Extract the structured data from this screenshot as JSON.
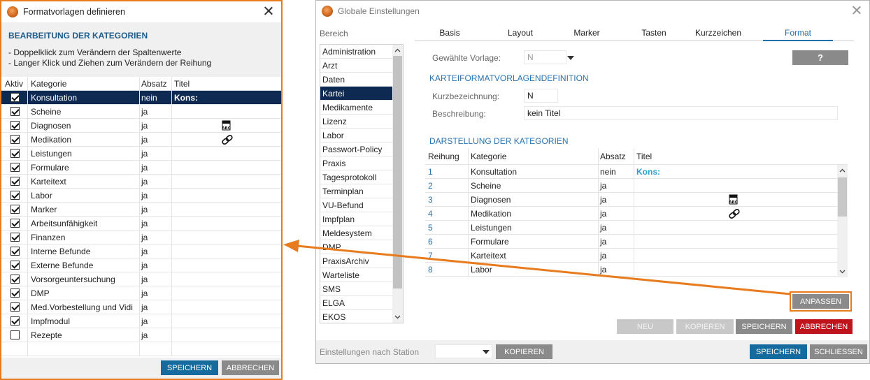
{
  "left_window": {
    "title": "Formatvorlagen definieren",
    "heading": "BEARBEITUNG DER KATEGORIEN",
    "instructions": [
      "- Doppelklick zum Verändern der Spaltenwerte",
      "- Langer Klick und Ziehen zum Verändern der Reihung"
    ],
    "columns": [
      "Aktiv",
      "Kategorie",
      "Absatz",
      "Titel"
    ],
    "rows": [
      {
        "checked": true,
        "kategorie": "Konsultation",
        "absatz": "nein",
        "titel": "Kons:",
        "icon": ""
      },
      {
        "checked": true,
        "kategorie": "Scheine",
        "absatz": "ja",
        "titel": "",
        "icon": ""
      },
      {
        "checked": true,
        "kategorie": "Diagnosen",
        "absatz": "ja",
        "titel": "",
        "icon": "abc-document-icon"
      },
      {
        "checked": true,
        "kategorie": "Medikation",
        "absatz": "ja",
        "titel": "",
        "icon": "pill-icon"
      },
      {
        "checked": true,
        "kategorie": "Leistungen",
        "absatz": "ja",
        "titel": "",
        "icon": ""
      },
      {
        "checked": true,
        "kategorie": "Formulare",
        "absatz": "ja",
        "titel": "",
        "icon": ""
      },
      {
        "checked": true,
        "kategorie": "Karteitext",
        "absatz": "ja",
        "titel": "",
        "icon": ""
      },
      {
        "checked": true,
        "kategorie": "Labor",
        "absatz": "ja",
        "titel": "",
        "icon": ""
      },
      {
        "checked": true,
        "kategorie": "Marker",
        "absatz": "ja",
        "titel": "",
        "icon": ""
      },
      {
        "checked": true,
        "kategorie": "Arbeitsunfähigkeit",
        "absatz": "ja",
        "titel": "",
        "icon": ""
      },
      {
        "checked": true,
        "kategorie": "Finanzen",
        "absatz": "ja",
        "titel": "",
        "icon": ""
      },
      {
        "checked": true,
        "kategorie": "Interne Befunde",
        "absatz": "ja",
        "titel": "",
        "icon": ""
      },
      {
        "checked": true,
        "kategorie": "Externe Befunde",
        "absatz": "ja",
        "titel": "",
        "icon": ""
      },
      {
        "checked": true,
        "kategorie": "Vorsorgeuntersuchung",
        "absatz": "ja",
        "titel": "",
        "icon": ""
      },
      {
        "checked": true,
        "kategorie": "DMP",
        "absatz": "ja",
        "titel": "",
        "icon": ""
      },
      {
        "checked": true,
        "kategorie": "Med.Vorbestellung und Vidi",
        "absatz": "ja",
        "titel": "",
        "icon": ""
      },
      {
        "checked": true,
        "kategorie": "Impfmodul",
        "absatz": "ja",
        "titel": "",
        "icon": ""
      },
      {
        "checked": false,
        "kategorie": "Rezepte",
        "absatz": "ja",
        "titel": "",
        "icon": ""
      }
    ],
    "save_label": "SPEICHERN",
    "cancel_label": "ABBRECHEN",
    "highlight_color": "#e77b1e",
    "selected_row_color": "#0f2a52"
  },
  "right_window": {
    "title": "Globale Einstellungen",
    "sidebar_label": "Bereich",
    "sidebar_items": [
      "Administration",
      "Arzt",
      "Daten",
      "Kartei",
      "Medikamente",
      "Lizenz",
      "Labor",
      "Passwort-Policy",
      "Praxis",
      "Tagesprotokoll",
      "Terminplan",
      "VU-Befund",
      "Impfplan",
      "Meldesystem",
      "DMP",
      "PraxisArchiv",
      "Warteliste",
      "SMS",
      "ELGA",
      "EKOS"
    ],
    "sidebar_selected": "Kartei",
    "tabs": [
      "Basis",
      "Layout",
      "Marker",
      "Tasten",
      "Kurzzeichen",
      "Format"
    ],
    "active_tab": "Format",
    "vorlage_label": "Gewählte Vorlage:",
    "vorlage_value": "N",
    "help_label": "?",
    "definition_heading": "KARTEIFORMATVORLAGENDEFINITION",
    "kurz_label": "Kurzbezeichnung:",
    "kurz_value": "N",
    "beschreibung_label": "Beschreibung:",
    "beschreibung_value": "kein Titel",
    "darstellung_heading": "DARSTELLUNG DER KATEGORIEN",
    "columns": [
      "Reihung",
      "Kategorie",
      "Absatz",
      "Titel"
    ],
    "rows": [
      {
        "reihung": "1",
        "kategorie": "Konsultation",
        "absatz": "nein",
        "titel": "Kons:",
        "icon": ""
      },
      {
        "reihung": "2",
        "kategorie": "Scheine",
        "absatz": "ja",
        "titel": "",
        "icon": ""
      },
      {
        "reihung": "3",
        "kategorie": "Diagnosen",
        "absatz": "ja",
        "titel": "",
        "icon": "abc-document-icon"
      },
      {
        "reihung": "4",
        "kategorie": "Medikation",
        "absatz": "ja",
        "titel": "",
        "icon": "pill-icon"
      },
      {
        "reihung": "5",
        "kategorie": "Leistungen",
        "absatz": "ja",
        "titel": "",
        "icon": ""
      },
      {
        "reihung": "6",
        "kategorie": "Formulare",
        "absatz": "ja",
        "titel": "",
        "icon": ""
      },
      {
        "reihung": "7",
        "kategorie": "Karteitext",
        "absatz": "ja",
        "titel": "",
        "icon": ""
      },
      {
        "reihung": "8",
        "kategorie": "Labor",
        "absatz": "ja",
        "titel": "",
        "icon": ""
      }
    ],
    "anpassen_label": "ANPASSEN",
    "neu_label": "NEU",
    "kopieren_label": "KOPIEREN",
    "speichern_label": "SPEICHERN",
    "abbrechen_label": "ABBRECHEN",
    "station_label": "Einstellungen nach Station",
    "station_kopieren_label": "KOPIEREN",
    "bottom_speichern_label": "SPEICHERN",
    "schliessen_label": "SCHLIESSEN"
  }
}
